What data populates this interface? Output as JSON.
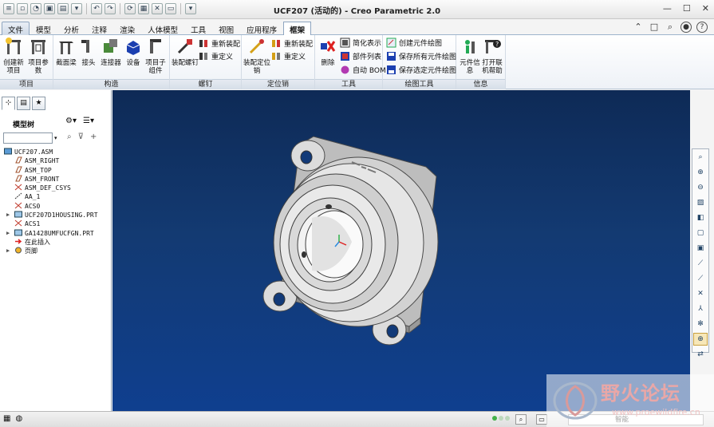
{
  "window": {
    "title": "UCF207 (活动的) - Creo Parametric 2.0"
  },
  "menu": {
    "tabs": [
      "文件",
      "模型",
      "分析",
      "注释",
      "渲染",
      "人体模型",
      "工具",
      "视图",
      "应用程序",
      "框架"
    ],
    "active_tab": "框架"
  },
  "ribbon": {
    "groups": {
      "project": "项目",
      "construct": "构造",
      "screw": "螺钉",
      "pin": "定位销",
      "tools": "工具",
      "drawing_tools": "绘图工具",
      "info": "信息"
    },
    "create_project": "创建新项目",
    "project_params": "项目参数",
    "section_beam": "截面梁",
    "connector": "接头",
    "connect": "连接器",
    "equipment": "设备",
    "project_subasm": "项目子组件",
    "place_screw": "装配螺钉",
    "reassemble_1": "重新装配",
    "redefine_1": "重定义",
    "place_pin": "装配定位销",
    "reassemble_2": "重新装配",
    "redefine_2": "重定义",
    "delete": "删除",
    "simplify": "简化表示",
    "parts_list": "部件列表",
    "auto_bom": "自动 BOM",
    "create_drawing": "创建元件绘图",
    "save_all_drawings": "保存所有元件绘图",
    "save_selected_drawings": "保存选定元件绘图",
    "component_info": "元件信息",
    "open_help": "打开联机帮助"
  },
  "panel": {
    "title": "模型树",
    "tree": [
      {
        "label": "UCF207.ASM",
        "icon": "assembly-icon",
        "level": 0,
        "expand": ""
      },
      {
        "label": "ASM_RIGHT",
        "icon": "datum-plane-icon",
        "level": 1,
        "expand": ""
      },
      {
        "label": "ASM_TOP",
        "icon": "datum-plane-icon",
        "level": 1,
        "expand": ""
      },
      {
        "label": "ASM_FRONT",
        "icon": "datum-plane-icon",
        "level": 1,
        "expand": ""
      },
      {
        "label": "ASM_DEF_CSYS",
        "icon": "csys-icon",
        "level": 1,
        "expand": ""
      },
      {
        "label": "AA_1",
        "icon": "axis-icon",
        "level": 1,
        "expand": ""
      },
      {
        "label": "ACS0",
        "icon": "csys-icon",
        "level": 1,
        "expand": ""
      },
      {
        "label": "UCF207D1HOUSING.PRT",
        "icon": "part-icon",
        "level": 1,
        "expand": "▶"
      },
      {
        "label": "ACS1",
        "icon": "csys-icon",
        "level": 1,
        "expand": ""
      },
      {
        "label": "GA1428UMFUCFGN.PRT",
        "icon": "part-icon",
        "level": 1,
        "expand": "▶"
      },
      {
        "label": "在此插入",
        "icon": "insert-here-icon",
        "level": 1,
        "expand": ""
      },
      {
        "label": "页脚",
        "icon": "footer-icon",
        "level": 1,
        "expand": "▶"
      }
    ]
  },
  "colors": {
    "viewport_top": "#0e2a56",
    "viewport_bottom": "#0f3f8f",
    "ribbon_accent": "#8fa6c0",
    "status_green": "#43b14a"
  },
  "status": {
    "filter_value": "智能"
  },
  "watermark": {
    "text": "野火论坛",
    "url": "www.proewildfire.cn"
  }
}
